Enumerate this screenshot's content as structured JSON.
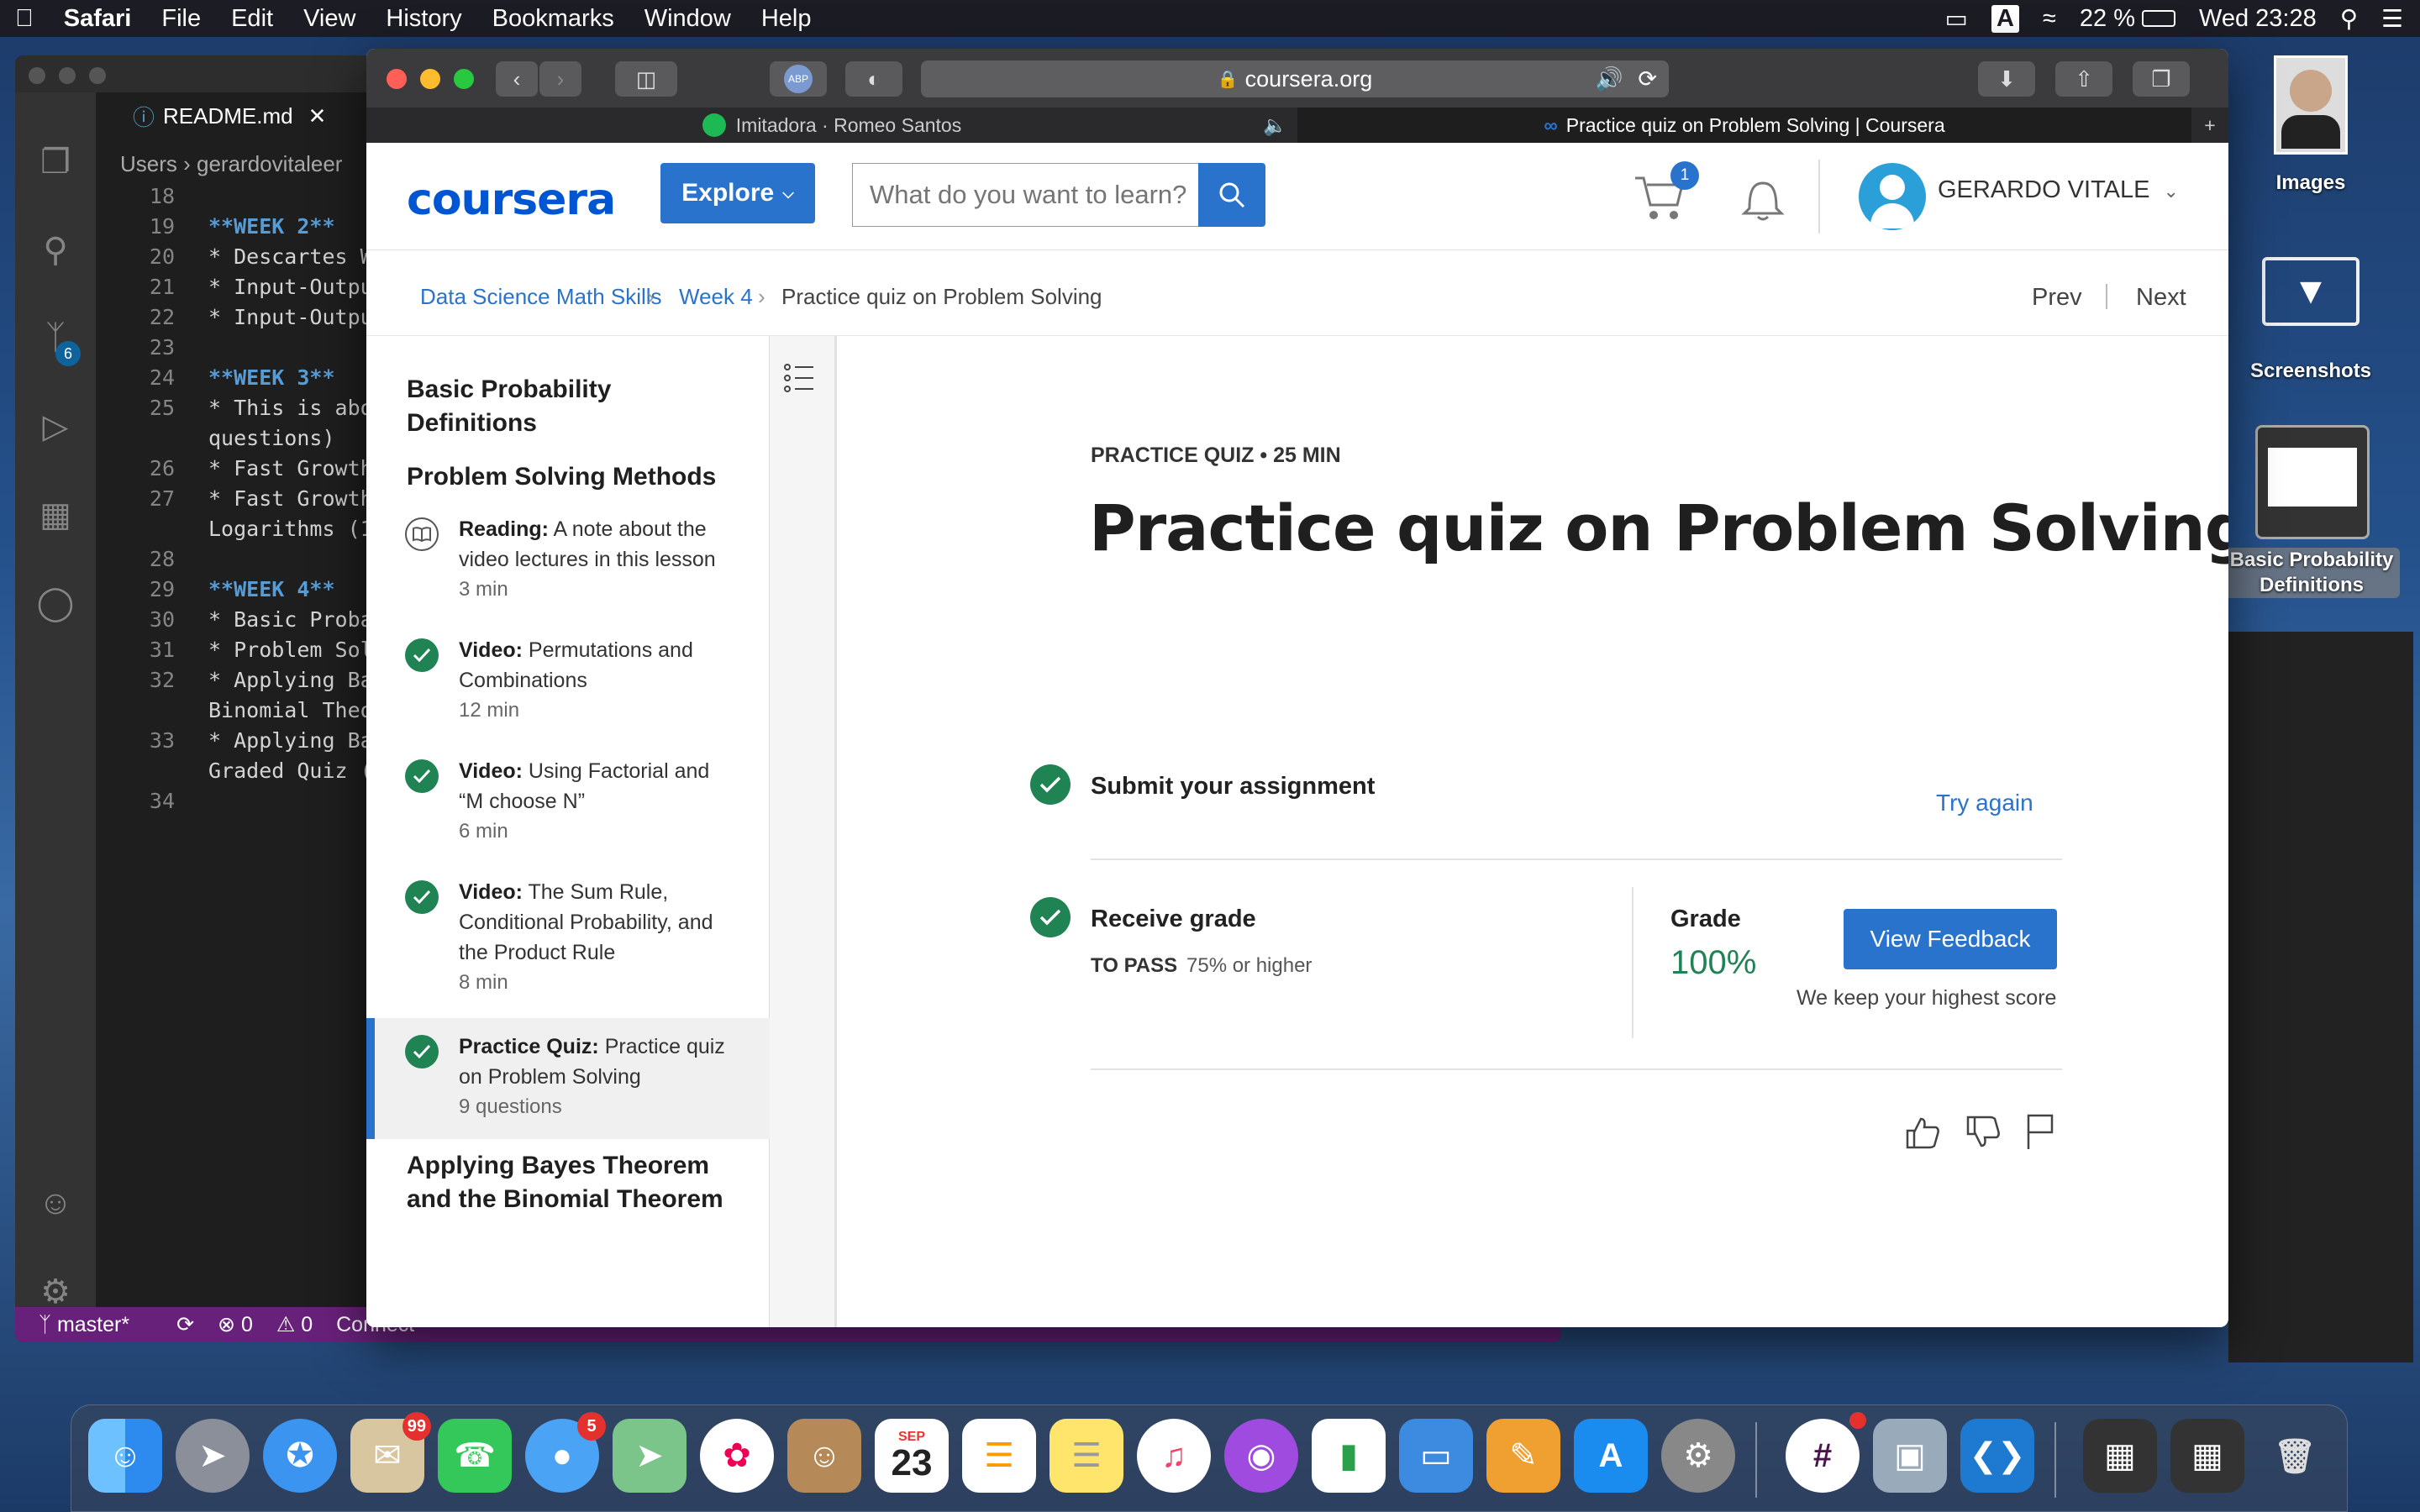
{
  "menubar": {
    "app": "Safari",
    "items": [
      "File",
      "Edit",
      "View",
      "History",
      "Bookmarks",
      "Window",
      "Help"
    ],
    "battery": "22 %",
    "input_source": "A",
    "clock": "Wed 23:28"
  },
  "vscode": {
    "tab": "README.md",
    "breadcrumb": "Users  ›  gerardovitaleer",
    "lines": [
      {
        "n": "18",
        "t": ""
      },
      {
        "n": "19",
        "t": "**WEEK 2**",
        "kw": true
      },
      {
        "n": "20",
        "t": "* Descartes Wa"
      },
      {
        "n": "21",
        "t": "* Input-Outpu"
      },
      {
        "n": "22",
        "t": "* Input-Outpu"
      },
      {
        "n": "23",
        "t": ""
      },
      {
        "n": "24",
        "t": "**WEEK 3**",
        "kw": true
      },
      {
        "n": "25",
        "t": "* This is abo"
      },
      {
        "n": "",
        "t": "questions)"
      },
      {
        "n": "26",
        "t": "* Fast Growth"
      },
      {
        "n": "27",
        "t": "* Fast Growth"
      },
      {
        "n": "",
        "t": "Logarithms (1"
      },
      {
        "n": "28",
        "t": ""
      },
      {
        "n": "29",
        "t": "**WEEK 4**",
        "kw": true
      },
      {
        "n": "30",
        "t": "* Basic Proba"
      },
      {
        "n": "31",
        "t": "* Problem Sol"
      },
      {
        "n": "32",
        "t": "* Applying Ba"
      },
      {
        "n": "",
        "t": "Binomial Theo"
      },
      {
        "n": "33",
        "t": "* Applying Ba"
      },
      {
        "n": "",
        "t": "Graded Quiz ("
      },
      {
        "n": "34",
        "t": ""
      }
    ],
    "status": {
      "branch": "master*",
      "errors": "⊗ 0",
      "warnings": "⚠ 0",
      "connect": "Connect"
    },
    "scm_badge": "6"
  },
  "desktop": {
    "images_label": "Images",
    "screenshots_label": "Screenshots",
    "file_label": "Basic Probability Definitions"
  },
  "safari": {
    "url": "coursera.org",
    "tabs": [
      {
        "title": "Imitadora · Romeo Santos"
      },
      {
        "title": "Practice quiz on Problem Solving | Coursera"
      }
    ],
    "abp": "ABP"
  },
  "coursera": {
    "logo": "coursera",
    "explore": "Explore",
    "search_placeholder": "What do you want to learn?",
    "cart_count": "1",
    "user": "GERARDO VITALE",
    "breadcrumb": [
      "Data Science Math Skills",
      "Week 4",
      "Practice quiz on Problem Solving"
    ],
    "prev": "Prev",
    "next": "Next",
    "sidebar": {
      "section1": "Basic Probability Definitions",
      "section2": "Problem Solving Methods",
      "items": [
        {
          "type": "Reading:",
          "title": "A note about the video lectures in this lesson",
          "meta": "3 min"
        },
        {
          "type": "Video:",
          "title": "Permutations and Combinations",
          "meta": "12 min"
        },
        {
          "type": "Video:",
          "title": "Using Factorial and “M choose N”",
          "meta": "6 min"
        },
        {
          "type": "Video:",
          "title": "The Sum Rule, Conditional Probability, and the Product Rule",
          "meta": "8 min"
        },
        {
          "type": "Practice Quiz:",
          "title": "Practice quiz on Problem Solving",
          "meta": "9 questions"
        }
      ],
      "section3": "Applying Bayes Theorem and the Binomial Theorem"
    },
    "main": {
      "kicker": "PRACTICE QUIZ • 25 MIN",
      "title": "Practice quiz on Problem Solving",
      "submit": "Submit your assignment",
      "try_again": "Try again",
      "receive": "Receive grade",
      "to_pass_label": "TO PASS",
      "to_pass_value": "75% or higher",
      "grade_label": "Grade",
      "grade_value": "100%",
      "view_feedback": "View Feedback",
      "keep_note": "We keep your highest score"
    }
  },
  "dock": {
    "mail_badge": "99",
    "messages_badge": "5",
    "calendar_month": "SEP",
    "calendar_day": "23"
  }
}
